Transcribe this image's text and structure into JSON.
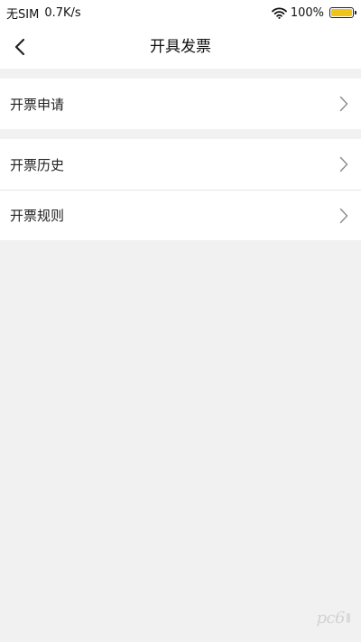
{
  "status_bar": {
    "carrier": "无SIM",
    "speed": "0.7K/s",
    "battery_percent": "100%",
    "battery_level": 1.0,
    "battery_color": "#f0c419",
    "wifi_icon": "wifi-icon"
  },
  "nav": {
    "back_icon": "back-chevron-icon",
    "title": "开具发票"
  },
  "menu": {
    "apply": "开票申请",
    "history": "开票历史",
    "rules": "开票规则",
    "chevron_icon": "chevron-right-icon"
  },
  "watermark": {
    "text": "pc6",
    "logo": "pc6-watermark-logo"
  },
  "colors": {
    "background": "#f1f1f1",
    "card": "#ffffff",
    "accent_battery": "#f0c419"
  }
}
